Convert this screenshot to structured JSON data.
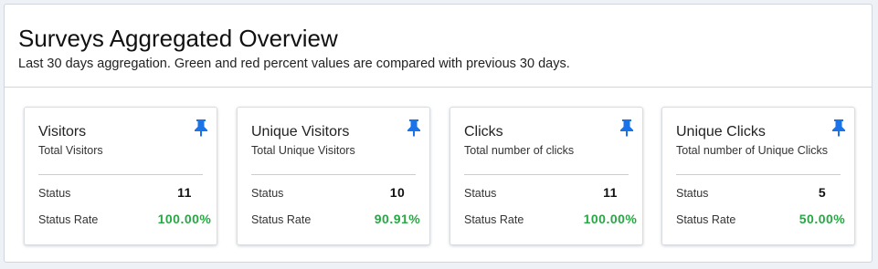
{
  "header": {
    "title": "Surveys Aggregated Overview",
    "subtitle": "Last 30 days aggregation. Green and red percent values are compared with previous 30 days."
  },
  "colors": {
    "accent": "#1a73e8",
    "positive": "#28a745",
    "pin_icon": "#1a73e8"
  },
  "cards": [
    {
      "title": "Visitors",
      "description": "Total Visitors",
      "icon": "pin-icon",
      "status_label": "Status",
      "status_value": "11",
      "rate_label": "Status Rate",
      "rate_value": "100.00%"
    },
    {
      "title": "Unique Visitors",
      "description": "Total Unique Visitors",
      "icon": "pin-icon",
      "status_label": "Status",
      "status_value": "10",
      "rate_label": "Status Rate",
      "rate_value": "90.91%"
    },
    {
      "title": "Clicks",
      "description": "Total number of clicks",
      "icon": "pin-icon",
      "status_label": "Status",
      "status_value": "11",
      "rate_label": "Status Rate",
      "rate_value": "100.00%"
    },
    {
      "title": "Unique Clicks",
      "description": "Total number of Unique Clicks",
      "icon": "pin-icon",
      "status_label": "Status",
      "status_value": "5",
      "rate_label": "Status Rate",
      "rate_value": "50.00%"
    }
  ]
}
